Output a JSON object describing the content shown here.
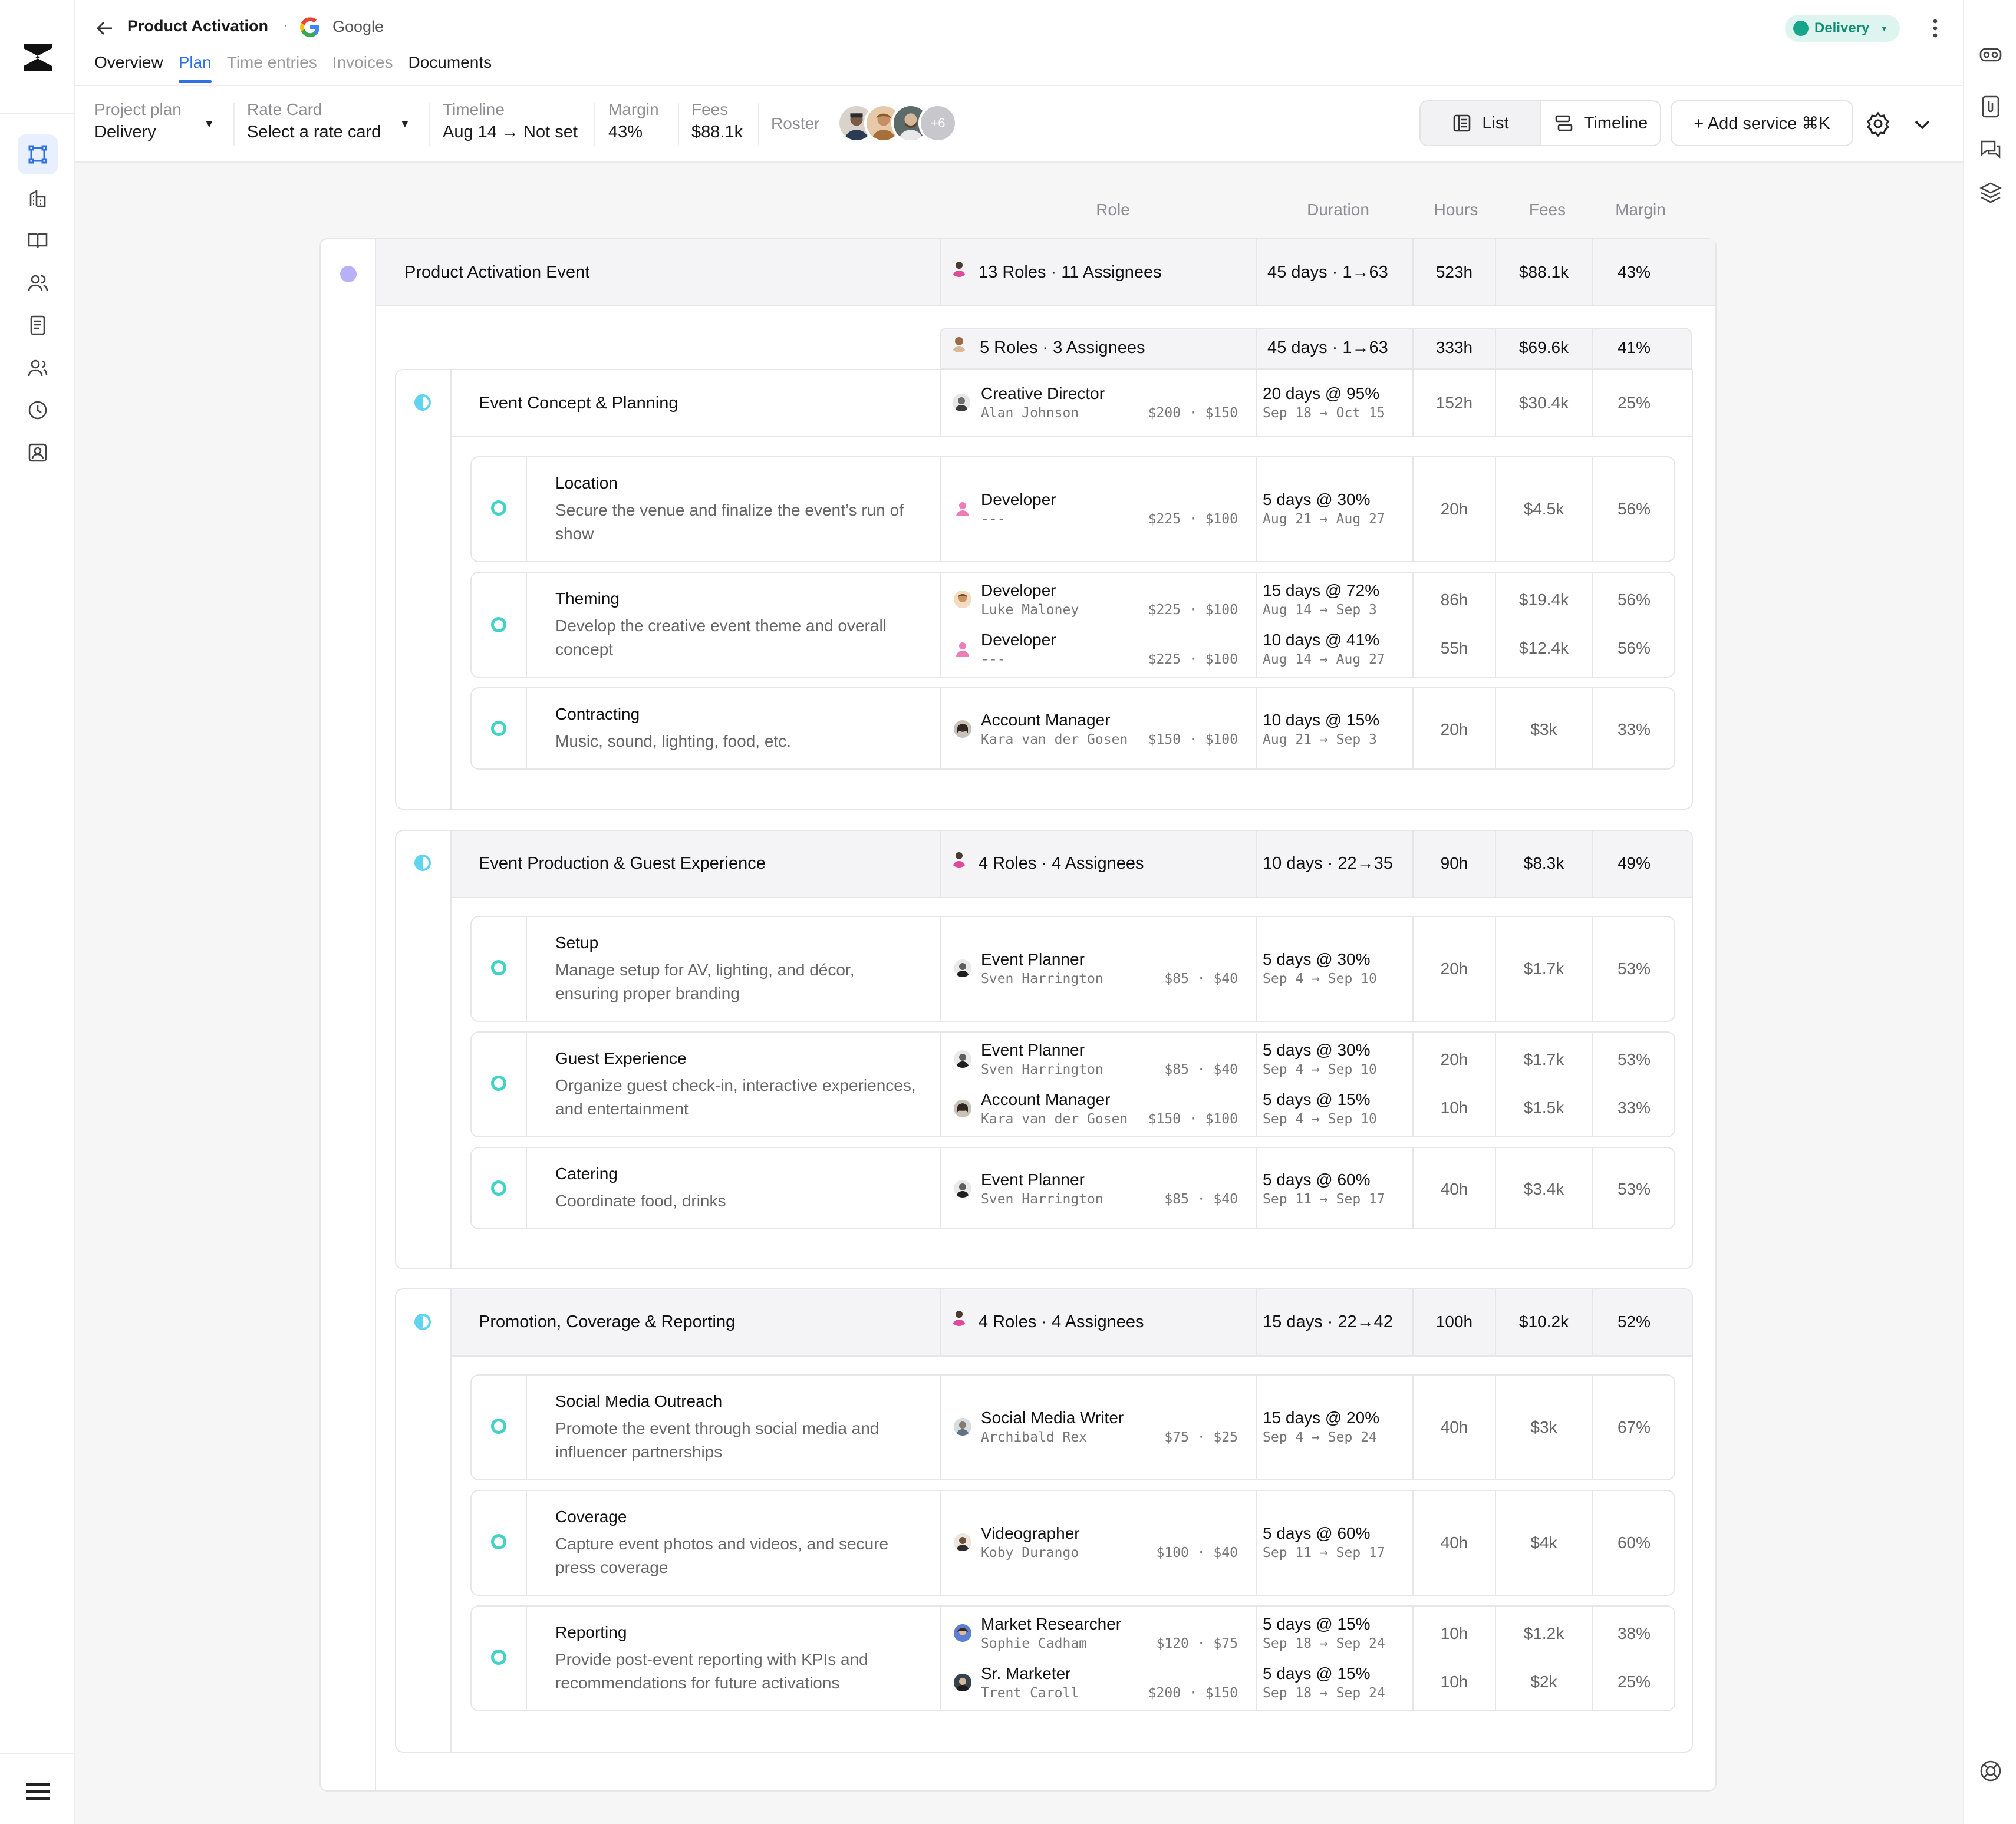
{
  "header": {
    "title": "Product Activation",
    "separator": "·",
    "client": "Google",
    "status": "Delivery",
    "tabs": [
      "Overview",
      "Plan",
      "Time entries",
      "Invoices",
      "Documents"
    ]
  },
  "toolbar": {
    "project_plan_label": "Project plan",
    "project_plan_value": "Delivery",
    "rate_card_label": "Rate Card",
    "rate_card_value": "Select a rate card",
    "timeline_label": "Timeline",
    "timeline_value": "Aug 14 → Not set",
    "margin_label": "Margin",
    "margin_value": "43%",
    "fees_label": "Fees",
    "fees_value": "$88.1k",
    "roster_label": "Roster",
    "roster_more": "+6",
    "view_list": "List",
    "view_timeline": "Timeline",
    "add_service": "+ Add service ⌘K"
  },
  "columns": [
    "Role",
    "Duration",
    "Hours",
    "Fees",
    "Margin"
  ],
  "project": {
    "name": "Product Activation Event",
    "roles": "13 Roles · 11 Assignees",
    "duration": "45 days · 1→63",
    "hours": "523h",
    "fees": "$88.1k",
    "margin": "43%"
  },
  "phase1": {
    "summary_roles": "5 Roles · 3 Assignees",
    "summary_duration": "45 days · 1→63",
    "summary_hours": "333h",
    "summary_fees": "$69.6k",
    "summary_margin": "41%",
    "name": "Event Concept & Planning",
    "role": "Creative Director",
    "person": "Alan Johnson",
    "rate": "$200 · $150",
    "duration": "20 days @ 95%",
    "dates": "Sep 18 → Oct 15",
    "hours": "152h",
    "fees": "$30.4k",
    "margin": "25%",
    "tasks": [
      {
        "name": "Location",
        "desc": "Secure the venue and finalize the event’s run of show",
        "assignments": [
          {
            "role": "Developer",
            "person": "---",
            "rate": "$225 · $100",
            "duration": "5 days @ 30%",
            "dates": "Aug 21 → Aug 27",
            "hours": "20h",
            "fees": "$4.5k",
            "margin": "56%"
          }
        ]
      },
      {
        "name": "Theming",
        "desc": "Develop the creative event theme and overall concept",
        "assignments": [
          {
            "role": "Developer",
            "person": "Luke Maloney",
            "rate": "$225 · $100",
            "duration": "15 days @ 72%",
            "dates": "Aug 14 → Sep 3",
            "hours": "86h",
            "fees": "$19.4k",
            "margin": "56%"
          },
          {
            "role": "Developer",
            "person": "---",
            "rate": "$225 · $100",
            "duration": "10 days @ 41%",
            "dates": "Aug 14 → Aug 27",
            "hours": "55h",
            "fees": "$12.4k",
            "margin": "56%"
          }
        ]
      },
      {
        "name": "Contracting",
        "desc": "Music, sound, lighting, food, etc.",
        "assignments": [
          {
            "role": "Account Manager",
            "person": "Kara van der Gosen",
            "rate": "$150 · $100",
            "duration": "10 days @ 15%",
            "dates": "Aug 21 → Sep 3",
            "hours": "20h",
            "fees": "$3k",
            "margin": "33%"
          }
        ]
      }
    ]
  },
  "phase2": {
    "name": "Event Production & Guest Experience",
    "roles": "4 Roles · 4 Assignees",
    "duration": "10 days · 22→35",
    "hours": "90h",
    "fees": "$8.3k",
    "margin": "49%",
    "tasks": [
      {
        "name": "Setup",
        "desc": "Manage setup for AV, lighting, and décor, ensuring proper branding",
        "assignments": [
          {
            "role": "Event Planner",
            "person": "Sven Harrington",
            "rate": "$85 · $40",
            "duration": "5 days @ 30%",
            "dates": "Sep 4 → Sep 10",
            "hours": "20h",
            "fees": "$1.7k",
            "margin": "53%"
          }
        ]
      },
      {
        "name": "Guest Experience",
        "desc": "Organize guest check-in, interactive experiences, and entertainment",
        "assignments": [
          {
            "role": "Event Planner",
            "person": "Sven Harrington",
            "rate": "$85 · $40",
            "duration": "5 days @ 30%",
            "dates": "Sep 4 → Sep 10",
            "hours": "20h",
            "fees": "$1.7k",
            "margin": "53%"
          },
          {
            "role": "Account Manager",
            "person": "Kara van der Gosen",
            "rate": "$150 · $100",
            "duration": "5 days @ 15%",
            "dates": "Sep 4 → Sep 10",
            "hours": "10h",
            "fees": "$1.5k",
            "margin": "33%"
          }
        ]
      },
      {
        "name": "Catering",
        "desc": "Coordinate food, drinks",
        "assignments": [
          {
            "role": "Event Planner",
            "person": "Sven Harrington",
            "rate": "$85 · $40",
            "duration": "5 days @ 60%",
            "dates": "Sep 11 → Sep 17",
            "hours": "40h",
            "fees": "$3.4k",
            "margin": "53%"
          }
        ]
      }
    ]
  },
  "phase3": {
    "name": "Promotion, Coverage & Reporting",
    "roles": "4 Roles · 4 Assignees",
    "duration": "15 days · 22→42",
    "hours": "100h",
    "fees": "$10.2k",
    "margin": "52%",
    "tasks": [
      {
        "name": "Social Media Outreach",
        "desc": "Promote the event through social media and influencer partnerships",
        "assignments": [
          {
            "role": "Social Media Writer",
            "person": "Archibald Rex",
            "rate": "$75 · $25",
            "duration": "15 days @ 20%",
            "dates": "Sep 4 → Sep 24",
            "hours": "40h",
            "fees": "$3k",
            "margin": "67%"
          }
        ]
      },
      {
        "name": "Coverage",
        "desc": "Capture event photos and videos, and secure press coverage",
        "assignments": [
          {
            "role": "Videographer",
            "person": "Koby Durango",
            "rate": "$100 · $40",
            "duration": "5 days @ 60%",
            "dates": "Sep 11 → Sep 17",
            "hours": "40h",
            "fees": "$4k",
            "margin": "60%"
          }
        ]
      },
      {
        "name": "Reporting",
        "desc": "Provide post-event reporting with KPIs and recommendations for future activations",
        "assignments": [
          {
            "role": "Market Researcher",
            "person": "Sophie Cadham",
            "rate": "$120 · $75",
            "duration": "5 days @ 15%",
            "dates": "Sep 18 → Sep 24",
            "hours": "10h",
            "fees": "$1.2k",
            "margin": "38%"
          },
          {
            "role": "Sr. Marketer",
            "person": "Trent Caroll",
            "rate": "$200 · $150",
            "duration": "5 days @ 15%",
            "dates": "Sep 18 → Sep 24",
            "hours": "10h",
            "fees": "$2k",
            "margin": "25%"
          }
        ]
      }
    ]
  },
  "colors": {
    "accent": "#2f6fe4",
    "status_bg": "#def5ef",
    "status_fg": "#0e8f74",
    "task_marker": "#43d3c6",
    "phase_marker": "#5fd3ef",
    "project_marker": "#b9b1f5"
  }
}
